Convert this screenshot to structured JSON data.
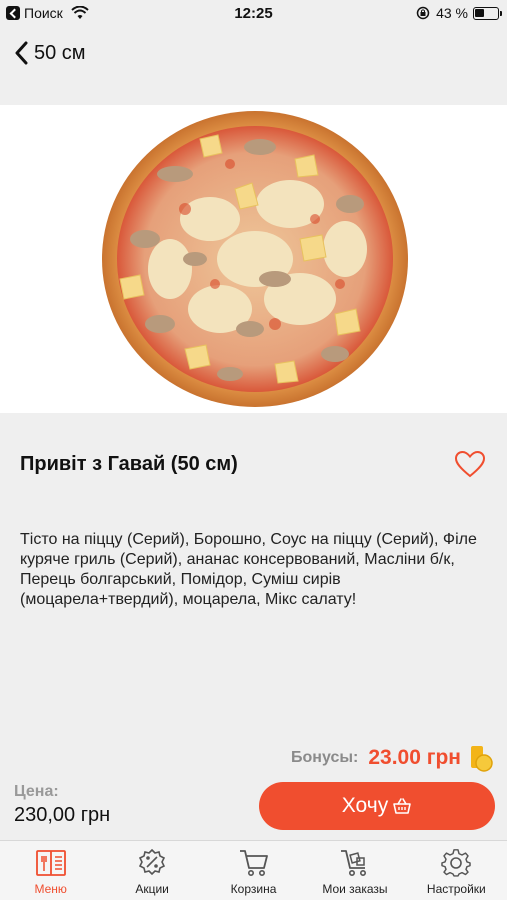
{
  "status_bar": {
    "back_app": "Поиск",
    "time": "12:25",
    "battery": "43 %"
  },
  "nav": {
    "title": "50 см"
  },
  "product": {
    "title": "Привіт з Гавай (50 см)",
    "description": "Тісто на піццу (Серий), Борошно, Соус на піццу (Серий), Філе куряче гриль (Серий), ананас консервований, Масліни б/к, Перець болгарський, Помідор, Суміш сирів (моцарела+твердий), моцарела, Мікс салату!"
  },
  "bonus": {
    "label": "Бонусы:",
    "value": "23.00 грн"
  },
  "price": {
    "label": "Цена:",
    "value": "230,00 грн"
  },
  "want_button": {
    "label": "Хочу"
  },
  "tabs": [
    {
      "label": "Меню",
      "icon": "menu-book-icon",
      "active": true
    },
    {
      "label": "Акции",
      "icon": "discount-icon",
      "active": false
    },
    {
      "label": "Корзина",
      "icon": "cart-icon",
      "active": false
    },
    {
      "label": "Мои заказы",
      "icon": "orders-cart-icon",
      "active": false
    },
    {
      "label": "Настройки",
      "icon": "gear-icon",
      "active": false
    }
  ],
  "colors": {
    "accent": "#f04e2f",
    "background": "#efefef"
  }
}
